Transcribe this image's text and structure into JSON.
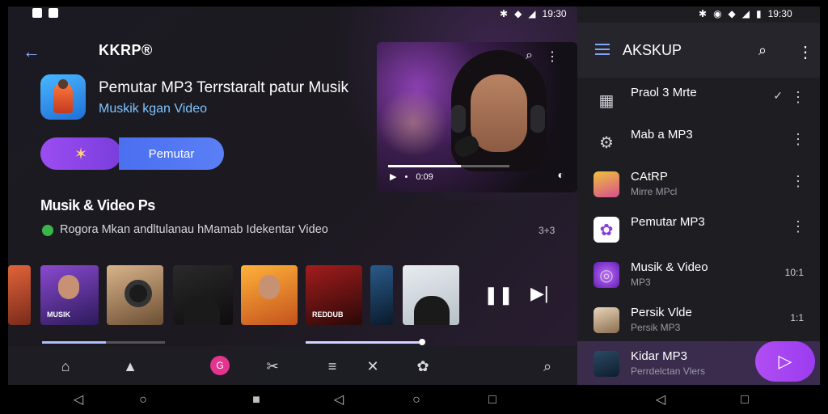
{
  "status_bar": {
    "left_time": "19:30",
    "right_time": "19:30"
  },
  "left": {
    "back_icon": "arrow-left-icon",
    "app_short_name": "KKRP®",
    "app_title": "Pemutar MP3 Terrstaralt patur Musik",
    "app_subtitle": "Muskik kgan Video",
    "buttons": {
      "primary_label": "Pemutar",
      "star_icon": "magic-star-icon"
    },
    "section_title": "Musik & Video Ps",
    "developer_line": "Rogora Mkan andltulanau hMamab Idekentar Video",
    "developer_count": "3+3",
    "video": {
      "time": "0:09",
      "progress_fraction": 0.6
    },
    "tiles": [
      {
        "caption": ""
      },
      {
        "caption": "MUSIK"
      },
      {
        "caption": ""
      },
      {
        "caption": ""
      },
      {
        "caption": ""
      },
      {
        "caption": "REDDUB"
      },
      {
        "caption": ""
      },
      {
        "caption": ""
      }
    ],
    "progress_a": 0.52,
    "progress_b": 0.97
  },
  "right": {
    "title": "AKSKUP",
    "items": [
      {
        "title": "Praol 3 Mrte",
        "subtitle": "",
        "value": "",
        "icon": "grid-icon",
        "trailing": "✓"
      },
      {
        "title": "Mab a MP3",
        "subtitle": "",
        "value": "",
        "icon": "gear-icon",
        "trailing": "⋮"
      },
      {
        "title": "CAtRP",
        "subtitle": "Mirre MPcl",
        "value": "",
        "icon": "album-art-icon",
        "trailing": "⋮"
      },
      {
        "title": "Pemutar MP3",
        "subtitle": "",
        "value": "",
        "icon": "flower-icon",
        "trailing": "⋮"
      },
      {
        "title": "Musik & Video",
        "subtitle": "MP3",
        "value": "10:1",
        "icon": "spiral-icon",
        "trailing": ""
      },
      {
        "title": "Persik Vlde",
        "subtitle": "Persik MP3",
        "value": "1:1",
        "icon": "album-art-icon",
        "trailing": ""
      },
      {
        "title": "Kidar MP3",
        "subtitle": "Perrdelctan Vlers",
        "value": "",
        "icon": "avatar-icon",
        "trailing": ""
      }
    ]
  },
  "system_nav": [
    "back-icon",
    "home-icon",
    "recents-icon",
    "back-icon",
    "home-icon",
    "recents-icon",
    "back-icon",
    "recents-icon"
  ]
}
